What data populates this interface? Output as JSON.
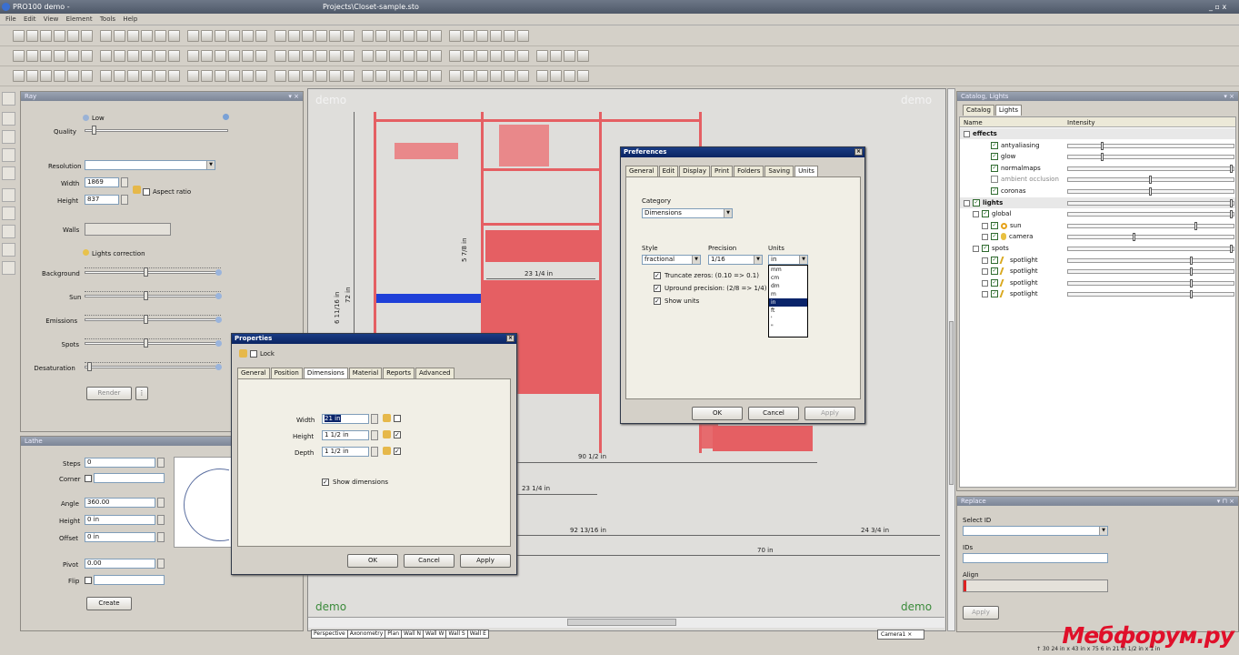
{
  "app": {
    "title": "PRO100 demo -",
    "project": "Projects\\Closet-sample.sto"
  },
  "menu": [
    "File",
    "Edit",
    "View",
    "Element",
    "Tools",
    "Help"
  ],
  "ray": {
    "title": "Ray",
    "quality_label": "Quality",
    "quality_low": "Low",
    "quality_level": 0.05,
    "resolution_label": "Resolution",
    "width_label": "Width",
    "width_value": "1869",
    "height_label": "Height",
    "height_value": "837",
    "aspect_label": "Aspect ratio",
    "walls_label": "Walls",
    "lights_correction": "Lights correction",
    "sliders": [
      {
        "label": "Background",
        "level": 0.45
      },
      {
        "label": "Sun",
        "level": 0.45
      },
      {
        "label": "Emissions",
        "level": 0.45
      },
      {
        "label": "Spots",
        "level": 0.45
      },
      {
        "label": "Desaturation",
        "level": 0.02
      }
    ],
    "render_label": "Render"
  },
  "lathe": {
    "title": "Lathe",
    "steps_label": "Steps",
    "steps_value": "0",
    "corner_label": "Corner",
    "angle_label": "Angle",
    "angle_value": "360.00",
    "height_label": "Height",
    "height_value": "0 in",
    "offset_label": "Offset",
    "offset_value": "0 in",
    "pivot_label": "Pivot",
    "pivot_value": "0.00",
    "flip_label": "Flip",
    "create_label": "Create"
  },
  "canvas": {
    "watermark": "demo",
    "dims": {
      "d1": "23 1/4 in",
      "d2": "90 1/2 in",
      "d3": "23 1/4 in",
      "d4": "92 13/16 in",
      "d5": "24 3/4 in",
      "d6": "70 in",
      "v1": "72 in",
      "v2": "6 11/16 in",
      "v3": "5 7/8 in"
    },
    "view_tabs": [
      "Perspective",
      "Axonometry",
      "Plan",
      "Wall N",
      "Wall W",
      "Wall S",
      "Wall E"
    ],
    "camera": "Camera1"
  },
  "properties": {
    "title": "Properties",
    "lock_label": "Lock",
    "tabs": [
      "General",
      "Position",
      "Dimensions",
      "Material",
      "Reports",
      "Advanced"
    ],
    "width_label": "Width",
    "width_value": "21 in",
    "height_label": "Height",
    "height_value": "1 1/2 in",
    "depth_label": "Depth",
    "depth_value": "1 1/2 in",
    "show_dimensions": "Show dimensions",
    "ok": "OK",
    "cancel": "Cancel",
    "apply": "Apply"
  },
  "preferences": {
    "title": "Preferences",
    "tabs": [
      "General",
      "Edit",
      "Display",
      "Print",
      "Folders",
      "Saving",
      "Units"
    ],
    "category_label": "Category",
    "category_value": "Dimensions",
    "style_label": "Style",
    "style_value": "fractional",
    "precision_label": "Precision",
    "precision_value": "1/16",
    "units_label": "Units",
    "units_value": "in",
    "units_options": [
      "mm",
      "cm",
      "dm",
      "m",
      "in",
      "ft",
      "'",
      "\""
    ],
    "truncate": "Truncate zeros:  (0.10 => 0.1)",
    "upround": "Upround  precision:  (2/8 => 1/4)",
    "show_units": "Show units",
    "ok": "OK",
    "cancel": "Cancel",
    "apply": "Apply"
  },
  "catalog": {
    "title": "Catalog, Lights",
    "tabs": [
      "Catalog",
      "Lights"
    ],
    "col_name": "Name",
    "col_intensity": "Intensity",
    "rows": [
      {
        "label": "effects",
        "indent": 0,
        "group": true,
        "chk": false,
        "level": null
      },
      {
        "label": "antyaliasing",
        "indent": 2,
        "group": false,
        "chk": true,
        "level": 0.2
      },
      {
        "label": "glow",
        "indent": 2,
        "group": false,
        "chk": true,
        "level": 0.2
      },
      {
        "label": "normalmaps",
        "indent": 2,
        "group": false,
        "chk": true,
        "level": 1.0
      },
      {
        "label": "ambient occlusion",
        "indent": 2,
        "group": false,
        "chk": false,
        "level": 0.5
      },
      {
        "label": "coronas",
        "indent": 2,
        "group": false,
        "chk": true,
        "level": 0.5
      },
      {
        "label": "lights",
        "indent": 0,
        "group": true,
        "chk": true,
        "level": 1.0
      },
      {
        "label": "global",
        "indent": 1,
        "group": false,
        "chk": true,
        "level": 1.0
      },
      {
        "label": "sun",
        "indent": 2,
        "group": false,
        "chk": true,
        "level": 0.78
      },
      {
        "label": "camera",
        "indent": 2,
        "group": false,
        "chk": true,
        "level": 0.4
      },
      {
        "label": "spots",
        "indent": 1,
        "group": false,
        "chk": true,
        "level": 1.0
      },
      {
        "label": "spotlight",
        "indent": 2,
        "group": false,
        "chk": true,
        "level": 0.75
      },
      {
        "label": "spotlight",
        "indent": 2,
        "group": false,
        "chk": true,
        "level": 0.75
      },
      {
        "label": "spotlight",
        "indent": 2,
        "group": false,
        "chk": true,
        "level": 0.75
      },
      {
        "label": "spotlight",
        "indent": 2,
        "group": false,
        "chk": true,
        "level": 0.75
      }
    ]
  },
  "replace": {
    "title": "Replace",
    "select_id": "Select ID",
    "ids": "IDs",
    "align": "Align",
    "apply": "Apply"
  },
  "watermark": "Мебфорум.ру",
  "status": "↑ 30  24 in x 43 in x 75  6 in  21 in  1/2 in x  1  in"
}
